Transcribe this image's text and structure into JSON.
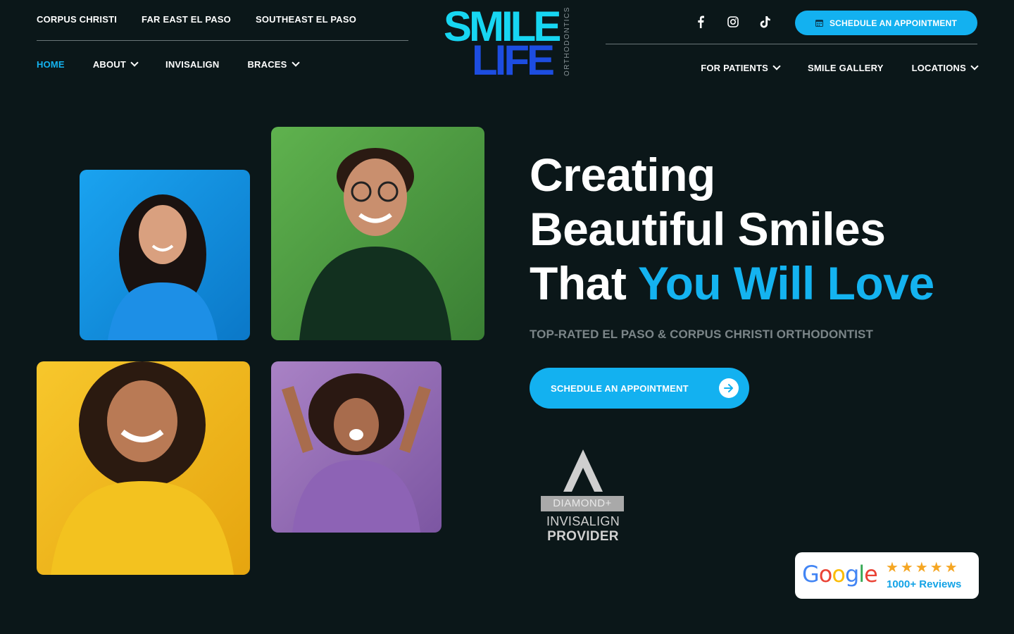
{
  "locations_nav": [
    "CORPUS CHRISTI",
    "FAR EAST EL PASO",
    "SOUTHEAST EL PASO"
  ],
  "main_nav_left": [
    {
      "label": "HOME",
      "active": true,
      "dropdown": false
    },
    {
      "label": "ABOUT",
      "active": false,
      "dropdown": true
    },
    {
      "label": "INVISALIGN",
      "active": false,
      "dropdown": false
    },
    {
      "label": "BRACES",
      "active": false,
      "dropdown": true
    }
  ],
  "main_nav_right": [
    {
      "label": "FOR PATIENTS",
      "dropdown": true
    },
    {
      "label": "SMILE GALLERY",
      "dropdown": false
    },
    {
      "label": "LOCATIONS",
      "dropdown": true
    }
  ],
  "logo": {
    "line1": "SMILE",
    "line2": "LIFE",
    "tagline": "ORTHODONTICS"
  },
  "social": [
    "facebook-icon",
    "instagram-icon",
    "tiktok-icon"
  ],
  "top_button": {
    "label": "SCHEDULE AN APPOINTMENT",
    "icon": "calendar-icon"
  },
  "hero": {
    "line1": "Creating",
    "line2": "Beautiful Smiles",
    "line3_plain": "That ",
    "line3_accent": "You Will Love",
    "subtitle": "TOP-RATED EL PASO & CORPUS CHRISTI ORTHODONTIST",
    "cta": "SCHEDULE AN APPOINTMENT"
  },
  "badge": {
    "tier": "DIAMOND+",
    "brand": "INVISALIGN",
    "role": "PROVIDER"
  },
  "reviews": {
    "brand": "Google",
    "stars": "★★★★★",
    "count": "1000+ Reviews"
  },
  "colors": {
    "accent": "#13b1f0",
    "background": "#0b1719",
    "logo_cyan": "#17d6f2",
    "logo_blue": "#1d4de0"
  }
}
